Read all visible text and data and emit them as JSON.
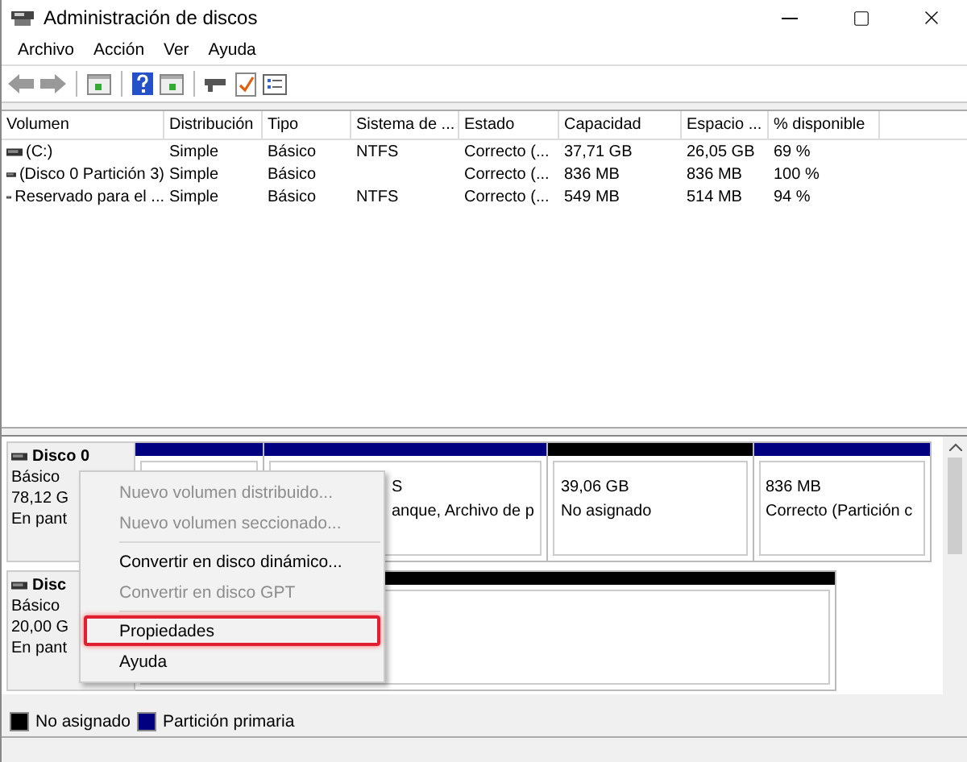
{
  "window": {
    "title": "Administración de discos"
  },
  "menu_bar": [
    "Archivo",
    "Acción",
    "Ver",
    "Ayuda"
  ],
  "volume_table": {
    "columns": [
      "Volumen",
      "Distribución",
      "Tipo",
      "Sistema de ...",
      "Estado",
      "Capacidad",
      "Espacio ...",
      "% disponible"
    ],
    "rows": [
      {
        "cells": [
          "(C:)",
          "Simple",
          "Básico",
          "NTFS",
          "Correcto (...",
          "37,71 GB",
          "26,05 GB",
          "69 %"
        ]
      },
      {
        "cells": [
          "(Disco 0 Partición 3)",
          "Simple",
          "Básico",
          "",
          "Correcto (...",
          "836 MB",
          "836 MB",
          "100 %"
        ]
      },
      {
        "cells": [
          "Reservado para el ...",
          "Simple",
          "Básico",
          "NTFS",
          "Correcto (...",
          "549 MB",
          "514 MB",
          "94 %"
        ]
      }
    ]
  },
  "disks": [
    {
      "name": "Disco 0",
      "lines": [
        "Básico",
        "78,12 G",
        "En pant"
      ],
      "partitions": [
        {
          "kind": "primary"
        },
        {
          "kind": "primary",
          "lines": [
            "S",
            "anque, Archivo de p"
          ]
        },
        {
          "kind": "unallocated",
          "lines": [
            "39,06 GB",
            "No asignado"
          ]
        },
        {
          "kind": "primary",
          "lines": [
            "836 MB",
            "Correcto (Partición c"
          ]
        }
      ]
    },
    {
      "name": "Disc",
      "lines": [
        "Básico",
        "20,00 G",
        "En pant"
      ],
      "partitions": [
        {
          "kind": "unallocated"
        }
      ]
    }
  ],
  "context_menu": [
    {
      "kind": "item",
      "label": "Nuevo volumen distribuido...",
      "disabled": true,
      "highlighted": false
    },
    {
      "kind": "item",
      "label": "Nuevo volumen seccionado...",
      "disabled": true,
      "highlighted": false
    },
    {
      "kind": "separator"
    },
    {
      "kind": "item",
      "label": "Convertir en disco dinámico...",
      "disabled": false,
      "highlighted": false
    },
    {
      "kind": "item",
      "label": "Convertir en disco GPT",
      "disabled": true,
      "highlighted": false
    },
    {
      "kind": "separator"
    },
    {
      "kind": "item",
      "label": "Propiedades",
      "disabled": false,
      "highlighted": true
    },
    {
      "kind": "item",
      "label": "Ayuda",
      "disabled": false,
      "highlighted": false
    }
  ],
  "legend": [
    {
      "label": "No asignado",
      "color": "#000000"
    },
    {
      "label": "Partición primaria",
      "color": "#000080"
    }
  ]
}
